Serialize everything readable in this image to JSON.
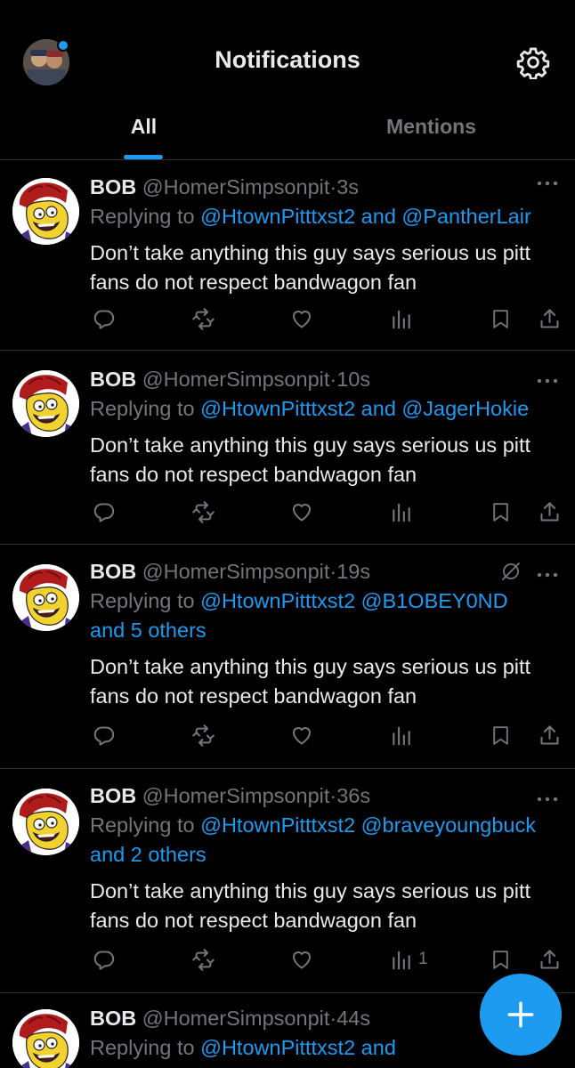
{
  "header": {
    "title": "Notifications",
    "has_new_dot": true
  },
  "tabs": [
    {
      "label": "All",
      "active": true
    },
    {
      "label": "Mentions",
      "active": false
    }
  ],
  "tweets": [
    {
      "name": "BOB",
      "handle": "@HomerSimpsonpit",
      "dot": "·",
      "time": "3s",
      "reply_prefix": "Replying to ",
      "reply_line1": "@HtownPitttxst2 and @PantherLair",
      "reply_line2": "",
      "text": "Don’t take anything this guy says serious us pitt fans do not respect bandwagon fan",
      "views": "",
      "muted_icon": false
    },
    {
      "name": "BOB",
      "handle": "@HomerSimpsonpit",
      "dot": "·",
      "time": "10s",
      "reply_prefix": "Replying to ",
      "reply_line1": "@HtownPitttxst2 and @JagerHokie",
      "reply_line2": "",
      "text": "Don’t take anything this guy says serious us pitt fans do not respect bandwagon fan",
      "views": "",
      "muted_icon": false
    },
    {
      "name": "BOB",
      "handle": "@HomerSimpsonpit",
      "dot": "·",
      "time": "19s",
      "reply_prefix": "Replying to ",
      "reply_line1": "@HtownPitttxst2 @B1OBEY0ND",
      "reply_line2": "and 5 others",
      "text": "Don’t take anything this guy says serious us pitt fans do not respect bandwagon fan",
      "views": "",
      "muted_icon": true
    },
    {
      "name": "BOB",
      "handle": "@HomerSimpsonpit",
      "dot": "·",
      "time": "36s",
      "reply_prefix": "Replying to ",
      "reply_line1": "@HtownPitttxst2 @braveyoungbuck",
      "reply_line2": "and 2 others",
      "text": "Don’t take anything this guy says serious us pitt fans do not respect bandwagon fan",
      "views": "1",
      "muted_icon": false
    },
    {
      "name": "BOB",
      "handle": "@HomerSimpsonpit",
      "dot": "·",
      "time": "44s",
      "reply_prefix": "Replying to ",
      "reply_line1": "@HtownPitttxst2 and",
      "reply_line2": "",
      "text": "",
      "views": "",
      "muted_icon": false
    }
  ],
  "icons": {
    "reply": "reply-icon",
    "retweet": "retweet-icon",
    "like": "heart-icon",
    "views": "views-icon",
    "bookmark": "bookmark-icon",
    "share": "share-icon",
    "settings": "gear-icon",
    "compose": "plus-icon"
  },
  "colors": {
    "background": "#000000",
    "text": "#e7e9ea",
    "muted": "#71767b",
    "accent": "#1d9bf0",
    "divider": "#2f3336"
  }
}
